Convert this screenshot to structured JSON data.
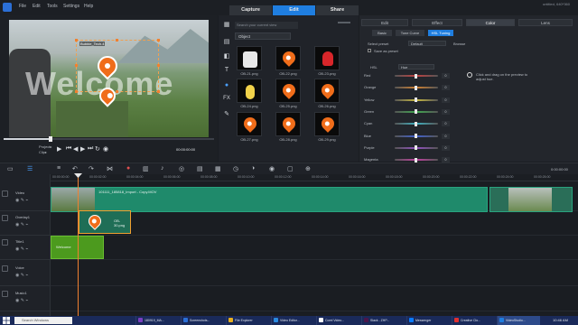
{
  "menu": [
    "File",
    "Edit",
    "Tools",
    "Settings",
    "Help"
  ],
  "project_name": "untitled, 640*360",
  "tabs": [
    {
      "label": "Capture",
      "active": false
    },
    {
      "label": "Edit",
      "active": true
    },
    {
      "label": "Share",
      "active": false
    }
  ],
  "preview": {
    "overlay_label": "Bubble_Tech.4",
    "watermark": "Welcome",
    "project_label": "Project▸",
    "clip_label": "Clip▸",
    "timecode": "00:00:00:00"
  },
  "library": {
    "search_placeholder": "Search your current view",
    "category": "Object",
    "items": [
      {
        "label": "OB-21.png",
        "kind": "square"
      },
      {
        "label": "OB-22.png",
        "kind": "pin"
      },
      {
        "label": "OB-23.png",
        "kind": "santa"
      },
      {
        "label": "OB-24.png",
        "kind": "figure"
      },
      {
        "label": "OB-25.png",
        "kind": "pin"
      },
      {
        "label": "OB-26.png",
        "kind": "pin"
      },
      {
        "label": "OB-27.png",
        "kind": "pin"
      },
      {
        "label": "OB-28.png",
        "kind": "pin"
      },
      {
        "label": "OB-29.png",
        "kind": "pin"
      }
    ]
  },
  "options": {
    "tabs": [
      {
        "label": "Edit",
        "active": false
      },
      {
        "label": "Effect",
        "active": false
      },
      {
        "label": "Color",
        "active": true
      },
      {
        "label": "Lens",
        "active": false
      }
    ],
    "subtabs": [
      {
        "label": "Basic",
        "active": false
      },
      {
        "label": "Tone Curve",
        "active": false
      },
      {
        "label": "HSL Tuning",
        "active": true
      }
    ],
    "select_preset_label": "Select preset",
    "preset_value": "Default",
    "browse_label": "Browse",
    "save_preset_label": "Save as preset",
    "hsl_label": "HSL",
    "hsl_mode": "Hue",
    "hint": "Click and drag on the preview to adjust hue.",
    "colors": [
      {
        "name": "Red",
        "value": "0",
        "gradient": "#c04040"
      },
      {
        "name": "Orange",
        "value": "0",
        "gradient": "#d08030"
      },
      {
        "name": "Yellow",
        "value": "0",
        "gradient": "#c8b840"
      },
      {
        "name": "Green",
        "value": "0",
        "gradient": "#40a850"
      },
      {
        "name": "Cyan",
        "value": "0",
        "gradient": "#40b0c0"
      },
      {
        "name": "Blue",
        "value": "0",
        "gradient": "#4060d0"
      },
      {
        "name": "Purple",
        "value": "0",
        "gradient": "#9050c0"
      },
      {
        "name": "Magenta",
        "value": "0",
        "gradient": "#c040a0"
      }
    ]
  },
  "timeline": {
    "timecode": "0:00:00:00",
    "ruler": [
      "00:00:00:00",
      "00:00:02:00",
      "00:00:04:00",
      "00:00:06:00",
      "00:00:08:00",
      "00:00:10:00",
      "00:00:12:00",
      "00:00:14:00",
      "00:00:16:00",
      "00:00:18:00",
      "00:00:20:00",
      "00:00:22:00",
      "00:00:24:00",
      "00:00:26:00"
    ],
    "tracks": [
      "Video",
      "Overlay1",
      "Title1",
      "Voice",
      "Music1"
    ],
    "video_clip": "101111_185818_Import - Copy.MOV",
    "overlay_clip": "OB-30.png",
    "title_clip": "Welcome"
  },
  "taskbar": {
    "search": "Search Windows",
    "items": [
      "180919_MA...",
      "Screenshots...",
      "File Explorer",
      "Video Editor...",
      "Corel Video...",
      "Slack - ZHP...",
      "Messenger",
      "Creative Clo...",
      "VideoStudio..."
    ],
    "clock": "10:46 AM"
  }
}
